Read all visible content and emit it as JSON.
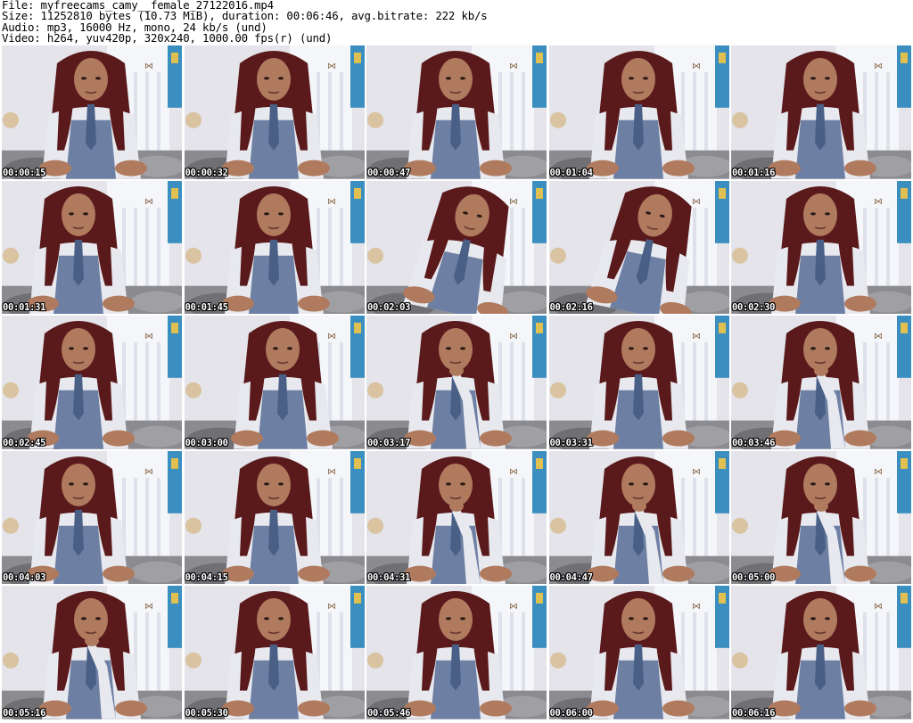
{
  "header": {
    "file_line": "File: myfreecams_camy__female_27122016.mp4",
    "size_line": "Size: 11252810 bytes (10.73 MiB), duration: 00:06:46, avg.bitrate: 222 kb/s",
    "audio_line": "Audio: mp3, 16000 Hz, mono, 24 kb/s (und)",
    "video_line": "Video: h264, yuv420p, 320x240, 1000.00 fps(r) (und)"
  },
  "thumbnails": [
    {
      "timestamp": "00:00:15",
      "pose": "center"
    },
    {
      "timestamp": "00:00:32",
      "pose": "center"
    },
    {
      "timestamp": "00:00:47",
      "pose": "center"
    },
    {
      "timestamp": "00:01:04",
      "pose": "center"
    },
    {
      "timestamp": "00:01:16",
      "pose": "center"
    },
    {
      "timestamp": "00:01:31",
      "pose": "left"
    },
    {
      "timestamp": "00:01:45",
      "pose": "center"
    },
    {
      "timestamp": "00:02:03",
      "pose": "lean"
    },
    {
      "timestamp": "00:02:16",
      "pose": "lean"
    },
    {
      "timestamp": "00:02:30",
      "pose": "center"
    },
    {
      "timestamp": "00:02:45",
      "pose": "left"
    },
    {
      "timestamp": "00:03:00",
      "pose": "right"
    },
    {
      "timestamp": "00:03:17",
      "pose": "hand"
    },
    {
      "timestamp": "00:03:31",
      "pose": "center"
    },
    {
      "timestamp": "00:03:46",
      "pose": "hand"
    },
    {
      "timestamp": "00:04:03",
      "pose": "left"
    },
    {
      "timestamp": "00:04:15",
      "pose": "center"
    },
    {
      "timestamp": "00:04:31",
      "pose": "hand"
    },
    {
      "timestamp": "00:04:47",
      "pose": "hand"
    },
    {
      "timestamp": "00:05:00",
      "pose": "hand"
    },
    {
      "timestamp": "00:05:16",
      "pose": "hand"
    },
    {
      "timestamp": "00:05:30",
      "pose": "center"
    },
    {
      "timestamp": "00:05:46",
      "pose": "center"
    },
    {
      "timestamp": "00:06:00",
      "pose": "center"
    },
    {
      "timestamp": "00:06:16",
      "pose": "center"
    }
  ],
  "colors": {
    "wall": "#e4e4ea",
    "window": "#f4f6fa",
    "hair": "#5a1a1c",
    "skin": "#b07a5e",
    "shirt": "#e8e9ee",
    "tie": "#4a5f86",
    "dress": "#6d7fa3",
    "bedding": "#8c8c90",
    "poster": "#3a8fc0",
    "timestamp_text": "#ffffff"
  }
}
